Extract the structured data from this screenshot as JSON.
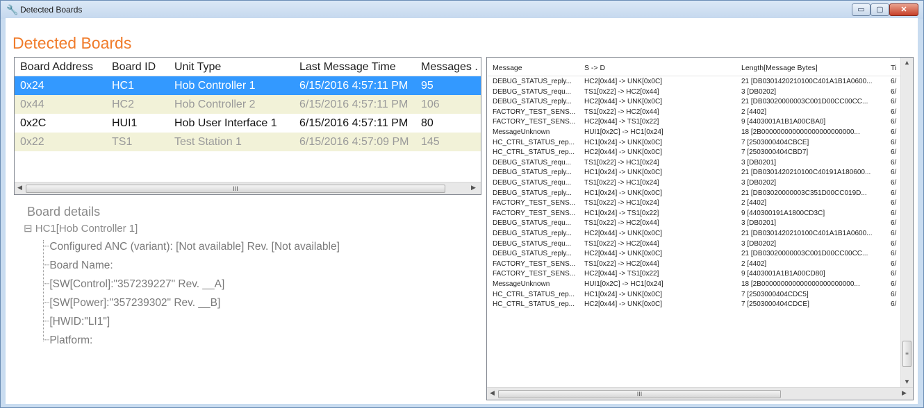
{
  "window": {
    "title": "Detected Boards",
    "min_glyph": "▭",
    "max_glyph": "▢",
    "close_glyph": "✕"
  },
  "heading": "Detected Boards",
  "boards": {
    "columns": [
      "Board Address",
      "Board ID",
      "Unit Type",
      "Last Message Time",
      "Messages ."
    ],
    "rows": [
      [
        "0x24",
        "HC1",
        "Hob Controller 1",
        "6/15/2016 4:57:11 PM",
        "95"
      ],
      [
        "0x44",
        "HC2",
        "Hob Controller 2",
        "6/15/2016 4:57:11 PM",
        "106"
      ],
      [
        "0x2C",
        "HUI1",
        "Hob User Interface 1",
        "6/15/2016 4:57:11 PM",
        "80"
      ],
      [
        "0x22",
        "TS1",
        "Test Station 1",
        "6/15/2016 4:57:09 PM",
        "145"
      ]
    ],
    "scroll_grip": "III"
  },
  "details": {
    "title": "Board details",
    "root": "HC1[Hob Controller 1]",
    "items": [
      "Configured ANC (variant): [Not available] Rev. [Not available]",
      "Board Name:",
      "[SW[Control]:\"357239227\" Rev. __A]",
      "[SW[Power]:\"357239302\" Rev. __B]",
      "[HWID:\"LI1\"]",
      "Platform:"
    ]
  },
  "messages": {
    "columns": [
      "Message",
      "S -> D",
      "Length[Message Bytes]",
      "Ti"
    ],
    "rows": [
      [
        "DEBUG_STATUS_reply...",
        "HC2[0x44] -> UNK[0x0C]",
        "21 [DB0301420210100C401A1B1A0600...",
        "6/"
      ],
      [
        "DEBUG_STATUS_requ...",
        "TS1[0x22] -> HC2[0x44]",
        "3 [DB0202]",
        "6/"
      ],
      [
        "DEBUG_STATUS_reply...",
        "HC2[0x44] -> UNK[0x0C]",
        "21 [DB03020000003C001D00CC00CC...",
        "6/"
      ],
      [
        "FACTORY_TEST_SENS...",
        "TS1[0x22] -> HC2[0x44]",
        "2 [4402]",
        "6/"
      ],
      [
        "FACTORY_TEST_SENS...",
        "HC2[0x44] -> TS1[0x22]",
        "9 [4403001A1B1A00CBA0]",
        "6/"
      ],
      [
        "MessageUnknown",
        "HUI1[0x2C] -> HC1[0x24]",
        "18 [2B000000000000000000000000...",
        "6/"
      ],
      [
        "HC_CTRL_STATUS_rep...",
        "HC1[0x24] -> UNK[0x0C]",
        "7 [2503000404CBCE]",
        "6/"
      ],
      [
        "HC_CTRL_STATUS_rep...",
        "HC2[0x44] -> UNK[0x0C]",
        "7 [2503000404CBD7]",
        "6/"
      ],
      [
        "DEBUG_STATUS_requ...",
        "TS1[0x22] -> HC1[0x24]",
        "3 [DB0201]",
        "6/"
      ],
      [
        "DEBUG_STATUS_reply...",
        "HC1[0x24] -> UNK[0x0C]",
        "21 [DB0301420210100C40191A180600...",
        "6/"
      ],
      [
        "DEBUG_STATUS_requ...",
        "TS1[0x22] -> HC1[0x24]",
        "3 [DB0202]",
        "6/"
      ],
      [
        "DEBUG_STATUS_reply...",
        "HC1[0x24] -> UNK[0x0C]",
        "21 [DB03020000003C351D00CC019D...",
        "6/"
      ],
      [
        "FACTORY_TEST_SENS...",
        "TS1[0x22] -> HC1[0x24]",
        "2 [4402]",
        "6/"
      ],
      [
        "FACTORY_TEST_SENS...",
        "HC1[0x24] -> TS1[0x22]",
        "9 [440300191A1800CD3C]",
        "6/"
      ],
      [
        "DEBUG_STATUS_requ...",
        "TS1[0x22] -> HC2[0x44]",
        "3 [DB0201]",
        "6/"
      ],
      [
        "DEBUG_STATUS_reply...",
        "HC2[0x44] -> UNK[0x0C]",
        "21 [DB0301420210100C401A1B1A0600...",
        "6/"
      ],
      [
        "DEBUG_STATUS_requ...",
        "TS1[0x22] -> HC2[0x44]",
        "3 [DB0202]",
        "6/"
      ],
      [
        "DEBUG_STATUS_reply...",
        "HC2[0x44] -> UNK[0x0C]",
        "21 [DB03020000003C001D00CC00CC...",
        "6/"
      ],
      [
        "FACTORY_TEST_SENS...",
        "TS1[0x22] -> HC2[0x44]",
        "2 [4402]",
        "6/"
      ],
      [
        "FACTORY_TEST_SENS...",
        "HC2[0x44] -> TS1[0x22]",
        "9 [4403001A1B1A00CD80]",
        "6/"
      ],
      [
        "MessageUnknown",
        "HUI1[0x2C] -> HC1[0x24]",
        "18 [2B000000000000000000000000...",
        "6/"
      ],
      [
        "HC_CTRL_STATUS_rep...",
        "HC1[0x24] -> UNK[0x0C]",
        "7 [2503000404CDC5]",
        "6/"
      ],
      [
        "HC_CTRL_STATUS_rep...",
        "HC2[0x44] -> UNK[0x0C]",
        "7 [2503000404CDCE]",
        "6/"
      ]
    ],
    "scroll_grip": "III",
    "vscroll_grip": "≡"
  },
  "colors": {
    "accent": "#f07b2a",
    "selection": "#3399ff",
    "alt_row": "#f2f2d8"
  }
}
